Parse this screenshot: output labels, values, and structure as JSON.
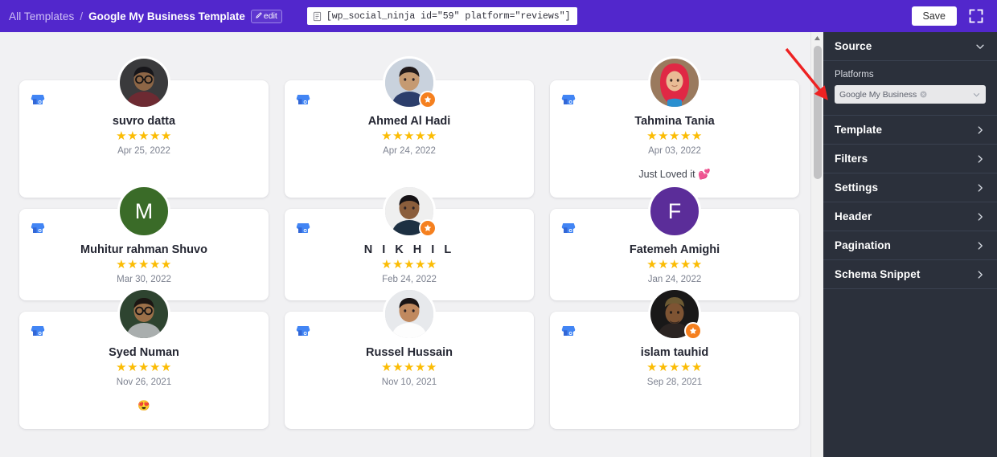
{
  "topbar": {
    "breadcrumb_root": "All Templates",
    "breadcrumb_sep": "/",
    "breadcrumb_current": "Google My Business Template",
    "edit_label": "edit",
    "shortcode": "[wp_social_ninja id=\"59\" platform=\"reviews\"]",
    "save_label": "Save",
    "expand_icon": "fullscreen-icon",
    "bg_color": "#5227cc"
  },
  "sidebar": {
    "bg_color": "#2b303b",
    "source": {
      "title": "Source",
      "expanded": true,
      "chevron": "chevron-down-icon",
      "platforms_label": "Platforms",
      "platform_tag": "Google My Business",
      "remove_icon": "remove-tag-icon",
      "caret_icon": "chevron-down-icon"
    },
    "sections": [
      {
        "label": "Template",
        "chevron": "chevron-right-icon"
      },
      {
        "label": "Filters",
        "chevron": "chevron-right-icon"
      },
      {
        "label": "Settings",
        "chevron": "chevron-right-icon"
      },
      {
        "label": "Header",
        "chevron": "chevron-right-icon"
      },
      {
        "label": "Pagination",
        "chevron": "chevron-right-icon"
      },
      {
        "label": "Schema Snippet",
        "chevron": "chevron-right-icon"
      }
    ]
  },
  "preview": {
    "platform_icon": "google-my-business-icon",
    "stars_glyph": "★★★★★",
    "reviews": [
      {
        "name": "suvro datta",
        "rating": 5,
        "date": "Apr 25, 2022",
        "text": "",
        "avatar_type": "photo",
        "photo_style": "man-glasses-dark",
        "local_guide": false,
        "initial": "",
        "initial_bg": ""
      },
      {
        "name": "Ahmed Al Hadi",
        "rating": 5,
        "date": "Apr 24, 2022",
        "text": "",
        "avatar_type": "photo",
        "photo_style": "man-suit-tie",
        "local_guide": true,
        "initial": "",
        "initial_bg": ""
      },
      {
        "name": "Tahmina Tania",
        "rating": 5,
        "date": "Apr 03, 2022",
        "text": "Just Loved it 💕",
        "avatar_type": "photo",
        "photo_style": "woman-red-hijab",
        "local_guide": false,
        "initial": "",
        "initial_bg": ""
      },
      {
        "name": "Muhitur rahman Shuvo",
        "rating": 5,
        "date": "Mar 30, 2022",
        "text": "",
        "avatar_type": "initial",
        "photo_style": "",
        "local_guide": false,
        "initial": "M",
        "initial_bg": "#3a6b28"
      },
      {
        "name": "N I K H I L",
        "rating": 5,
        "date": "Feb 24, 2022",
        "text": "",
        "avatar_type": "photo",
        "photo_style": "young-man-dark",
        "local_guide": true,
        "initial": "",
        "initial_bg": ""
      },
      {
        "name": "Fatemeh Amighi",
        "rating": 5,
        "date": "Jan 24, 2022",
        "text": "",
        "avatar_type": "initial",
        "photo_style": "",
        "local_guide": false,
        "initial": "F",
        "initial_bg": "#5b2d99"
      },
      {
        "name": "Syed Numan",
        "rating": 5,
        "date": "Nov 26, 2021",
        "text": "😍",
        "avatar_type": "photo",
        "photo_style": "man-sunglasses-green",
        "local_guide": false,
        "initial": "",
        "initial_bg": ""
      },
      {
        "name": "Russel Hussain",
        "rating": 5,
        "date": "Nov 10, 2021",
        "text": "",
        "avatar_type": "photo",
        "photo_style": "man-white-shirt",
        "local_guide": false,
        "initial": "",
        "initial_bg": ""
      },
      {
        "name": "islam tauhid",
        "rating": 5,
        "date": "Sep 28, 2021",
        "text": "",
        "avatar_type": "photo",
        "photo_style": "man-cap-dark",
        "local_guide": true,
        "initial": "",
        "initial_bg": ""
      }
    ]
  },
  "scrollbar": {
    "up_arrow_icon": "scroll-up-arrow-icon",
    "thumb": "scroll-thumb"
  },
  "annotation": {
    "arrow_color": "#ee2222",
    "target": "platforms-select"
  }
}
